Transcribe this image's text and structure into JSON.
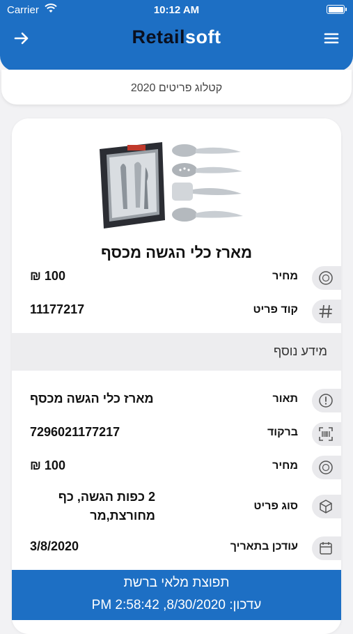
{
  "status_bar": {
    "carrier": "Carrier",
    "time": "10:12 AM",
    "battery_level": 1.0
  },
  "header": {
    "logo_part1": "Retail",
    "logo_part2": "soft",
    "back_icon": "arrow-right-icon",
    "menu_icon": "hamburger-menu-icon"
  },
  "catalog": {
    "title": "קטלוג פריטים 2020"
  },
  "product": {
    "image": "serving-utensils-set-image",
    "title": "מארז כלי הגשה מכסף",
    "price_label": "מחיר",
    "price_value": "100 ₪",
    "code_label": "קוד פריט",
    "code_value": "11177217"
  },
  "additional_info": {
    "header": "מידע נוסף",
    "rows": [
      {
        "label": "תאור",
        "value": "מארז כלי הגשה מכסף",
        "icon": "info-circle-icon"
      },
      {
        "label": "ברקוד",
        "value": "7296021177217",
        "icon": "barcode-scan-icon"
      },
      {
        "label": "מחיר",
        "value": "100 ₪",
        "icon": "coin-icon"
      },
      {
        "label": "סוג פריט",
        "value_line1": "2 כפות הגשה, כף",
        "value_line2": "מחורצת,מר",
        "icon": "box-icon"
      },
      {
        "label": "עודכן בתאריך",
        "value": "3/8/2020",
        "icon": "calendar-icon"
      }
    ]
  },
  "banner": {
    "line1": "תפוצת מלאי ברשת",
    "line2": "עדכון: 8/30/2020, 2:58:42 PM"
  },
  "colors": {
    "primary": "#1d6fc4",
    "pill": "#e9e9ec",
    "background": "#f2f2f4"
  }
}
